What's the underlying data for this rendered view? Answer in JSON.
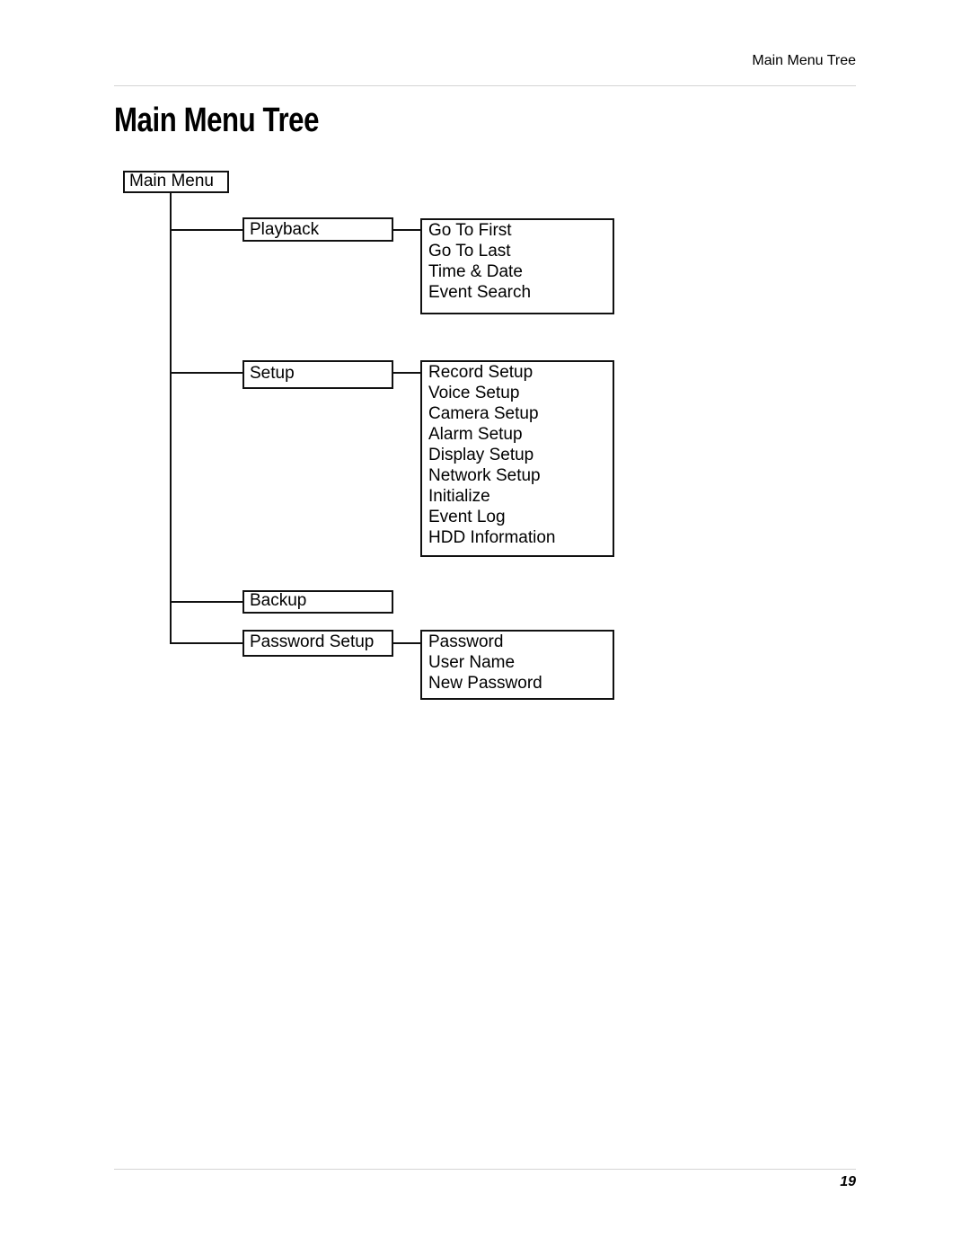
{
  "header": {
    "running_head": "Main Menu Tree"
  },
  "page": {
    "title": "Main Menu Tree",
    "number": "19"
  },
  "tree": {
    "root": "Main Menu",
    "branches": [
      {
        "label": "Playback",
        "children": [
          "Go To First",
          "Go To Last",
          "Time & Date",
          "Event Search"
        ]
      },
      {
        "label": "Setup",
        "children": [
          "Record Setup",
          "Voice Setup",
          "Camera Setup",
          "Alarm Setup",
          "Display Setup",
          "Network Setup",
          "Initialize",
          "Event Log",
          "HDD Information"
        ]
      },
      {
        "label": "Backup",
        "children": []
      },
      {
        "label": "Password Setup",
        "children": [
          "Password",
          "User Name",
          "New Password"
        ]
      }
    ]
  }
}
